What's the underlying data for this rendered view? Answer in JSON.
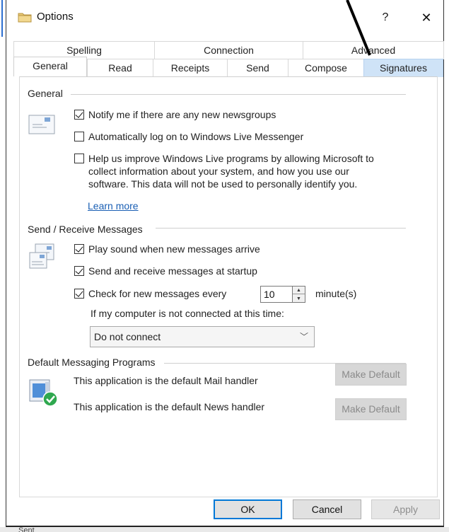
{
  "window": {
    "title": "Options",
    "help": "?",
    "close": "✕"
  },
  "tabs": {
    "row1": [
      "Spelling",
      "Connection",
      "Advanced"
    ],
    "row2": [
      "General",
      "Read",
      "Receipts",
      "Send",
      "Compose",
      "Signatures"
    ],
    "active": "General",
    "highlighted": "Signatures"
  },
  "general": {
    "heading": "General",
    "notify_label": "Notify me if there are any new newsgroups",
    "notify_checked": true,
    "autolog_label": "Automatically log on to Windows Live Messenger",
    "autolog_checked": false,
    "help_line1": "Help us improve Windows Live programs by allowing Microsoft to",
    "help_line2": "collect information about your system, and how you use our",
    "help_line3": "software. This data will not be used to personally identify you.",
    "help_checked": false,
    "learn_more": "Learn more"
  },
  "send_receive": {
    "heading": "Send / Receive Messages",
    "play_sound_label": "Play sound when new messages arrive",
    "play_sound_checked": true,
    "startup_label": "Send and receive messages at startup",
    "startup_checked": true,
    "check_label": "Check for new messages every",
    "check_checked": true,
    "minutes_value": "10",
    "minutes_unit": "minute(s)",
    "not_connected_label": "If my computer is not connected at this time:",
    "connect_option": "Do not connect"
  },
  "default_programs": {
    "heading": "Default Messaging Programs",
    "mail_text": "This application is the default Mail handler",
    "news_text": "This application is the default News handler",
    "make_default_mail": "Make Default",
    "make_default_news": "Make Default"
  },
  "footer": {
    "ok": "OK",
    "cancel": "Cancel",
    "apply": "Apply"
  },
  "background_text": "Sent",
  "colors": {
    "accent": "#0078d7",
    "tab_highlight": "#cfe3f7",
    "link": "#1a5fb4"
  }
}
